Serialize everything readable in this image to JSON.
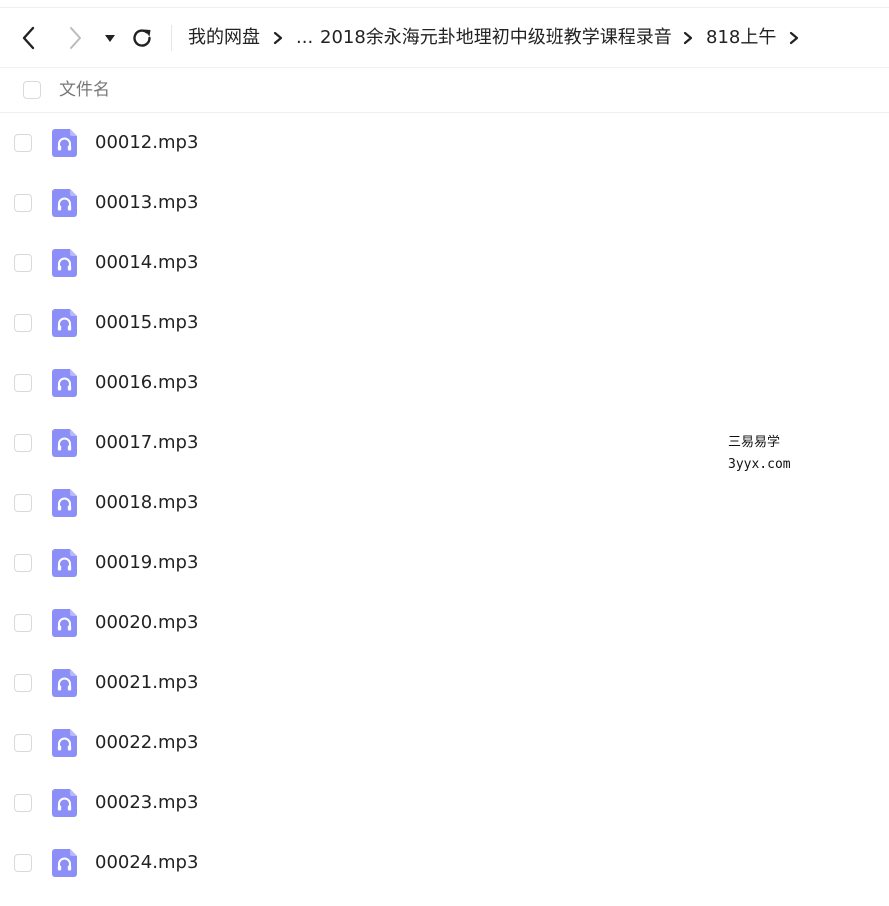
{
  "toolbar": {
    "back_icon": "chevron-left-icon",
    "forward_icon": "chevron-right-icon",
    "history_dropdown_icon": "caret-down-icon",
    "refresh_icon": "refresh-icon",
    "breadcrumb": {
      "root": "我的网盘",
      "ellipsis": "...",
      "folder": "2018余永海元卦地理初中级班教学课程录音",
      "current": "818上午",
      "separator_icon": "chevron-right-icon"
    }
  },
  "list": {
    "header_label": "文件名",
    "files": [
      {
        "name": "00012.mp3",
        "icon": "audio-file-icon"
      },
      {
        "name": "00013.mp3",
        "icon": "audio-file-icon"
      },
      {
        "name": "00014.mp3",
        "icon": "audio-file-icon"
      },
      {
        "name": "00015.mp3",
        "icon": "audio-file-icon"
      },
      {
        "name": "00016.mp3",
        "icon": "audio-file-icon"
      },
      {
        "name": "00017.mp3",
        "icon": "audio-file-icon"
      },
      {
        "name": "00018.mp3",
        "icon": "audio-file-icon"
      },
      {
        "name": "00019.mp3",
        "icon": "audio-file-icon"
      },
      {
        "name": "00020.mp3",
        "icon": "audio-file-icon"
      },
      {
        "name": "00021.mp3",
        "icon": "audio-file-icon"
      },
      {
        "name": "00022.mp3",
        "icon": "audio-file-icon"
      },
      {
        "name": "00023.mp3",
        "icon": "audio-file-icon"
      },
      {
        "name": "00024.mp3",
        "icon": "audio-file-icon"
      }
    ]
  },
  "watermark": {
    "line1": "三易易学",
    "line2": "3yyx.com"
  },
  "colors": {
    "audio_icon": "#8b8ff7",
    "text": "#222222",
    "border": "#f0f0f0"
  }
}
